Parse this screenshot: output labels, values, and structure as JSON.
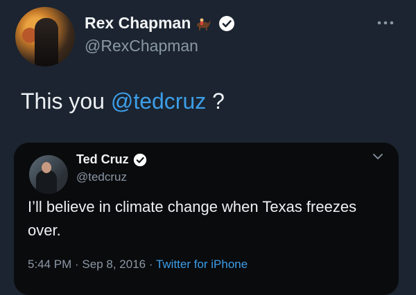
{
  "tweet": {
    "author": {
      "name": "Rex Chapman",
      "handle": "@RexChapman",
      "avatar_icon": "profile-photo",
      "emoji_icon": "horse-racing-icon",
      "verified": true
    },
    "text_prefix": "This you ",
    "mention": "@tedcruz",
    "text_suffix": " ?",
    "more_icon": "more-icon"
  },
  "quoted_tweet": {
    "author": {
      "name": "Ted Cruz",
      "handle": "@tedcruz",
      "avatar_icon": "profile-photo",
      "verified": true
    },
    "text": "I’ll believe in climate change when Texas freezes over.",
    "time": "5:44 PM",
    "separator": " · ",
    "date": "Sep 8, 2016",
    "source": "Twitter for iPhone",
    "chevron_icon": "chevron-down-icon"
  },
  "colors": {
    "background": "#1b2430",
    "quote_background": "#0a0b0d",
    "link": "#3d9ee8",
    "secondary_text": "#8b98a5"
  }
}
